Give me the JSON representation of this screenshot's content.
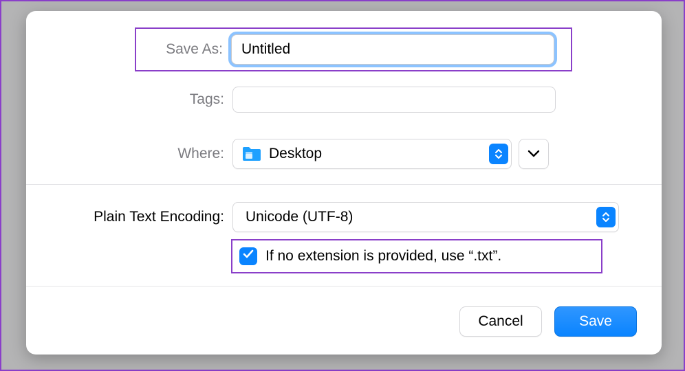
{
  "labels": {
    "save_as": "Save As:",
    "tags": "Tags:",
    "where": "Where:",
    "encoding": "Plain Text Encoding:"
  },
  "fields": {
    "save_as_value": "Untitled",
    "tags_value": "",
    "where_value": "Desktop",
    "encoding_value": "Unicode (UTF-8)"
  },
  "checkbox": {
    "checked": true,
    "label": "If no extension is provided, use “.txt”."
  },
  "buttons": {
    "cancel": "Cancel",
    "save": "Save"
  },
  "icons": {
    "folder": "folder-icon",
    "stepper": "stepper-icon",
    "expand": "chevron-down-icon",
    "check": "checkmark-icon"
  },
  "colors": {
    "accent": "#0a84ff",
    "highlight": "#8a3fc9"
  }
}
